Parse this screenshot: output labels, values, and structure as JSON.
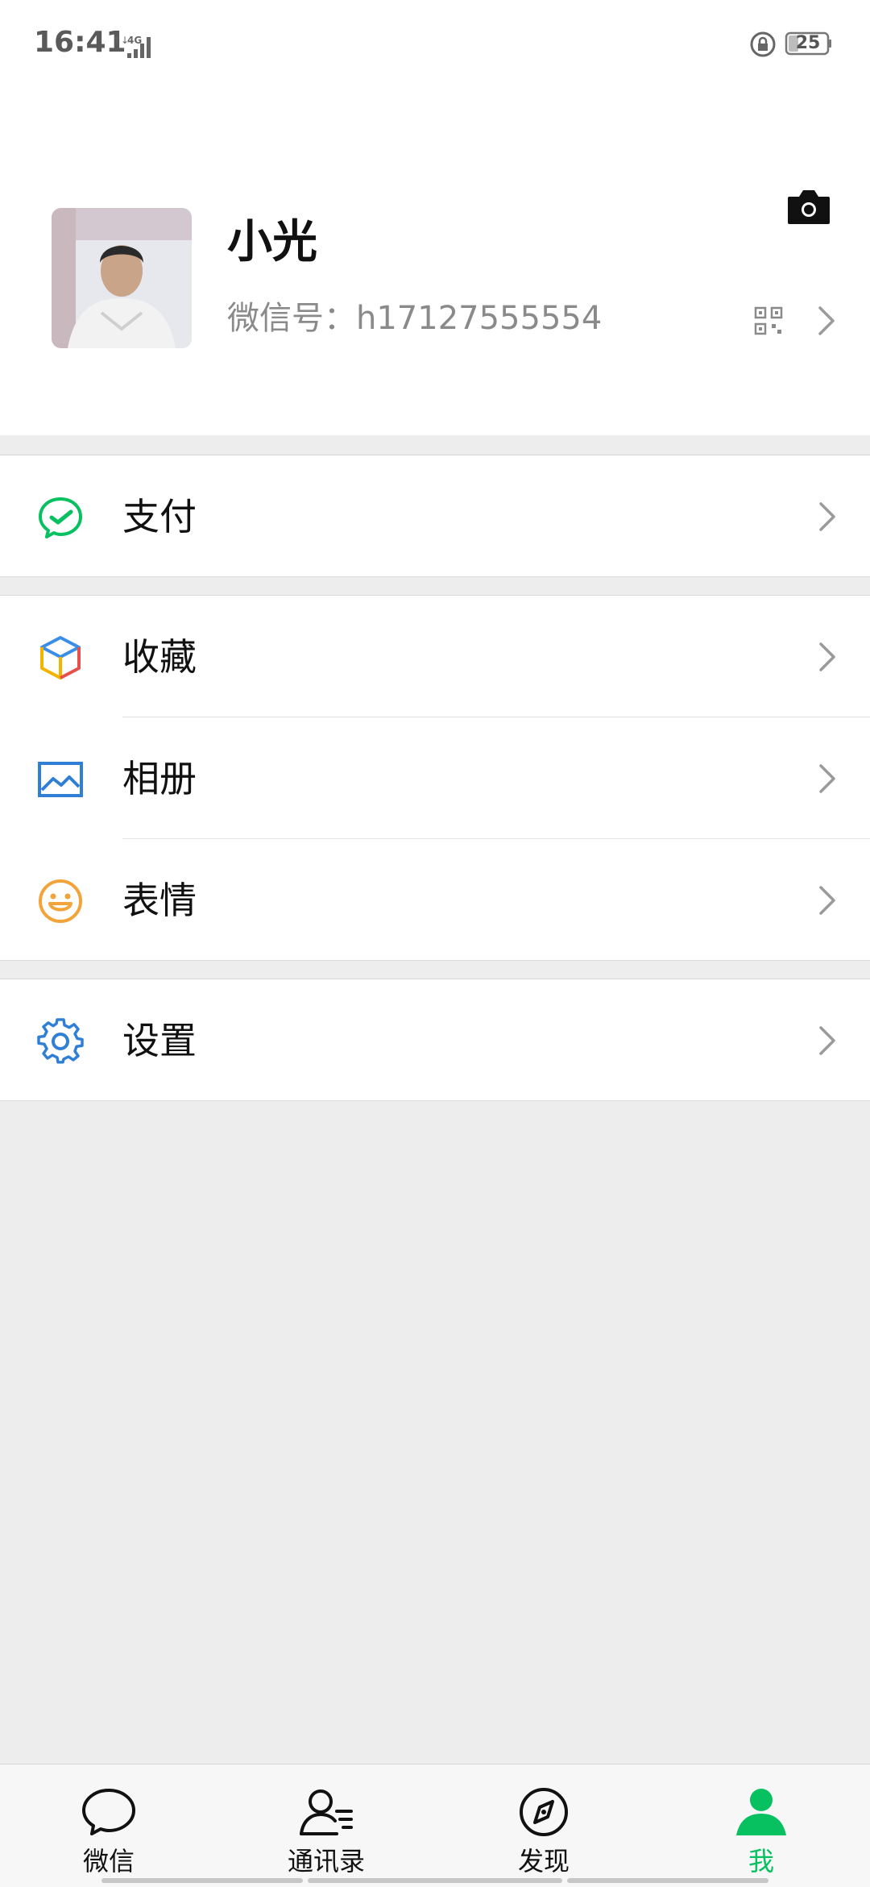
{
  "status_bar": {
    "time": "16:41",
    "network": "4G",
    "battery": "25"
  },
  "profile": {
    "name": "小光",
    "wechat_id": "微信号：h17127555554",
    "camera_icon": "camera-icon",
    "qr_icon": "qr-code-icon"
  },
  "menu": {
    "pay": {
      "label": "支付",
      "icon": "wechat-pay-icon",
      "color": "#07c160"
    },
    "favorites": {
      "label": "收藏",
      "icon": "favorites-cube-icon"
    },
    "album": {
      "label": "相册",
      "icon": "album-image-icon",
      "color": "#2f7fd6"
    },
    "stickers": {
      "label": "表情",
      "icon": "sticker-smile-icon",
      "color": "#f2a33a"
    },
    "settings": {
      "label": "设置",
      "icon": "gear-icon",
      "color": "#2f7fd6"
    }
  },
  "tabbar": {
    "tabs": [
      {
        "label": "微信",
        "icon": "chat-bubble-icon",
        "active": false
      },
      {
        "label": "通讯录",
        "icon": "contacts-icon",
        "active": false
      },
      {
        "label": "发现",
        "icon": "compass-icon",
        "active": false
      },
      {
        "label": "我",
        "icon": "me-person-icon",
        "active": true
      }
    ],
    "active_color": "#07c160"
  }
}
